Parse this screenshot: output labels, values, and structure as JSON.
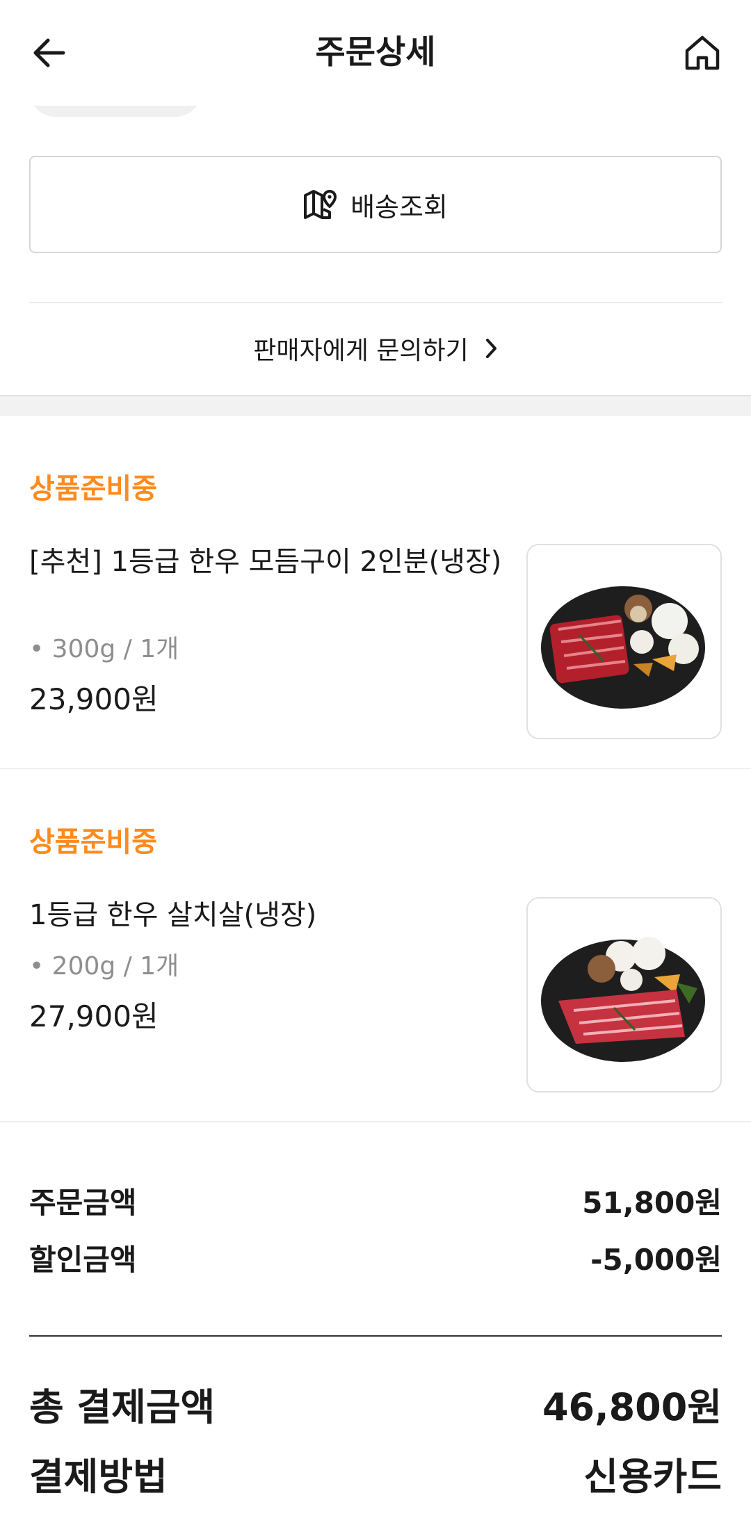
{
  "header": {
    "title": "주문상세",
    "back_icon": "arrow-left-icon",
    "home_icon": "home-icon"
  },
  "actions": {
    "tracking_label": "배송조회",
    "tracking_icon": "map-pin-icon",
    "inquiry_label": "판매자에게 문의하기",
    "inquiry_icon": "chevron-right-icon"
  },
  "items": [
    {
      "status": "상품준비중",
      "name": "[추천] 1등급 한우 모듬구이 2인분(냉장)",
      "option": "• 300g / 1개",
      "price": "23,900원"
    },
    {
      "status": "상품준비중",
      "name": "1등급 한우 살치살(냉장)",
      "option": "• 200g / 1개",
      "price": "27,900원"
    }
  ],
  "summary": {
    "order_amount_label": "주문금액",
    "order_amount_value": "51,800원",
    "discount_label": "할인금액",
    "discount_value": "-5,000원",
    "total_label": "총 결제금액",
    "total_value": "46,800원",
    "payment_method_label": "결제방법",
    "payment_method_value": "신용카드"
  },
  "colors": {
    "status_orange": "#ff8a1d",
    "text": "#1a1a1a",
    "option_gray": "#8e8e8e"
  }
}
